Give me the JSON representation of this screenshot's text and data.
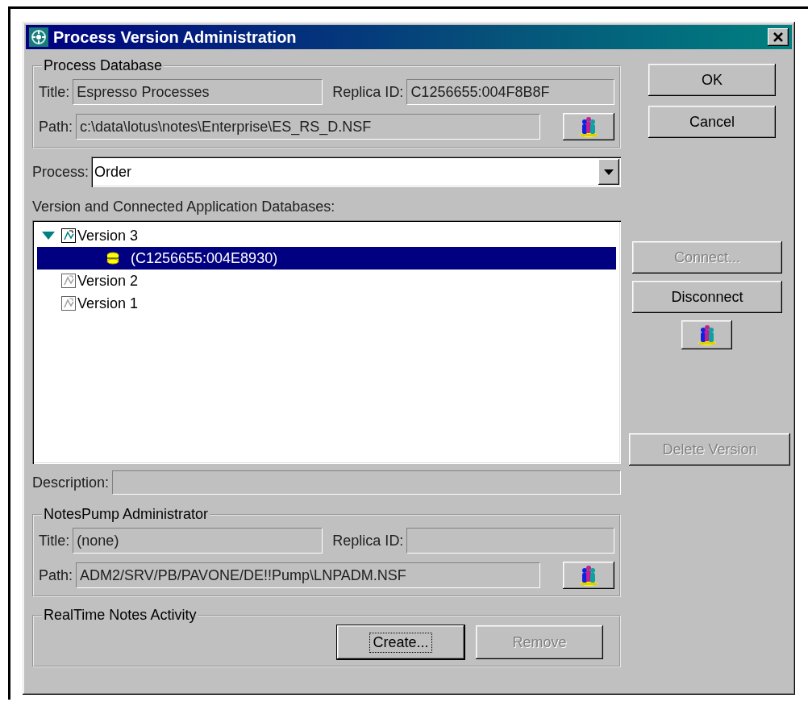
{
  "window": {
    "title": "Process Version Administration"
  },
  "process_database": {
    "legend": "Process Database",
    "title_label": "Title:",
    "title": "Espresso Processes",
    "replica_label": "Replica ID:",
    "replica_id": "C1256655:004F8B8F",
    "path_label": "Path:",
    "path": "c:\\data\\lotus\\notes\\Enterprise\\ES_RS_D.NSF"
  },
  "process": {
    "label": "Process:",
    "value": "Order"
  },
  "versions": {
    "label": "Version and Connected Application Databases:",
    "tree": [
      {
        "label": "Version 3",
        "kind": "version",
        "active": true,
        "expanded": true,
        "selected": false,
        "children": [
          {
            "label": "(C1256655:004E8930)",
            "kind": "database",
            "selected": true
          }
        ]
      },
      {
        "label": "Version 2",
        "kind": "version",
        "active": false,
        "selected": false
      },
      {
        "label": "Version 1",
        "kind": "version",
        "active": false,
        "selected": false
      }
    ]
  },
  "description": {
    "label": "Description:"
  },
  "notespump": {
    "legend": "NotesPump Administrator",
    "title_label": "Title:",
    "title": "(none)",
    "replica_label": "Replica ID:",
    "path_label": "Path:",
    "path": "ADM2/SRV/PB/PAVONE/DE!!Pump\\LNPADM.NSF"
  },
  "realtime": {
    "legend": "RealTime Notes Activity",
    "buttons": [
      {
        "label": "Create...",
        "disabled": false,
        "focused": true
      },
      {
        "label": "Remove",
        "disabled": true,
        "focused": false
      }
    ]
  },
  "side_buttons": [
    {
      "kind": "text",
      "label": "OK",
      "disabled": false
    },
    {
      "kind": "text",
      "label": "Cancel",
      "disabled": false
    },
    {
      "kind": "text",
      "label": "Connect...",
      "disabled": true
    },
    {
      "kind": "text",
      "label": "Disconnect",
      "disabled": false
    },
    {
      "kind": "icon",
      "disabled": false
    },
    {
      "kind": "text",
      "label": "Delete Version",
      "disabled": true
    }
  ]
}
